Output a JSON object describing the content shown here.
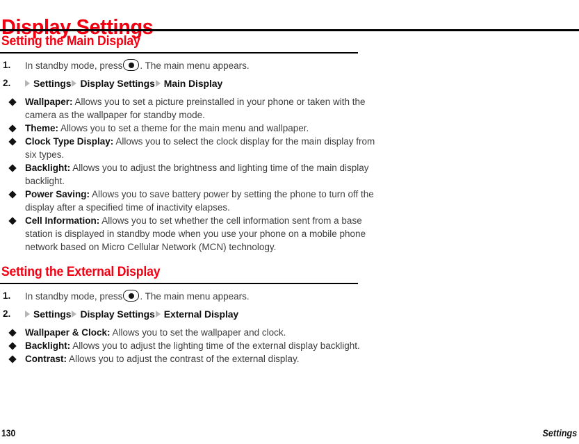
{
  "document": {
    "title": "Display Settings",
    "accent_color": "#f20012",
    "text_color": "#3d3d3d",
    "bullet_glyph": "diamond",
    "key_icon": "center-select-key-icon",
    "path_arrow_icon": "triangle-right-icon"
  },
  "sections": [
    {
      "heading": "Setting the Main Display",
      "steps": [
        {
          "number": "1.",
          "text_before_icon": "In standby mode, press",
          "text_after_icon": ". The main menu appears."
        },
        {
          "number": "2.",
          "path": [
            "Settings",
            "Display Settings",
            "Main Display"
          ]
        }
      ],
      "bullets": [
        {
          "label": "Wallpaper:",
          "description": "Allows you to set a picture preinstalled in your phone or taken with the camera as the wallpaper for standby mode."
        },
        {
          "label": "Theme:",
          "description": "Allows you to set a theme for the main menu and wallpaper."
        },
        {
          "label": "Clock Type Display:",
          "description": "Allows you to select the clock display for the main display from six types."
        },
        {
          "label": "Backlight:",
          "description": "Allows you to adjust the brightness and lighting time of the main display backlight."
        },
        {
          "label": "Power Saving:",
          "description": "Allows you to save battery power by setting the phone to turn off the display after a specified time of inactivity elapses."
        },
        {
          "label": "Cell Information:",
          "description": "Allows you to set whether the cell information sent from a base station is displayed in standby mode when you use your phone on a mobile phone network based on Micro Cellular Network (MCN) technology."
        }
      ]
    },
    {
      "heading": "Setting the External Display",
      "steps": [
        {
          "number": "1.",
          "text_before_icon": "In standby mode, press",
          "text_after_icon": ". The main menu appears."
        },
        {
          "number": "2.",
          "path": [
            "Settings",
            "Display Settings",
            "External Display"
          ]
        }
      ],
      "bullets": [
        {
          "label": "Wallpaper & Clock:",
          "description": "Allows you to set the wallpaper and clock."
        },
        {
          "label": "Backlight:",
          "description": "Allows you to adjust the lighting time of the external display backlight."
        },
        {
          "label": "Contrast:",
          "description": "Allows you to adjust the contrast of the external display."
        }
      ]
    }
  ],
  "footer": {
    "page_number": "130",
    "section_name": "Settings"
  }
}
